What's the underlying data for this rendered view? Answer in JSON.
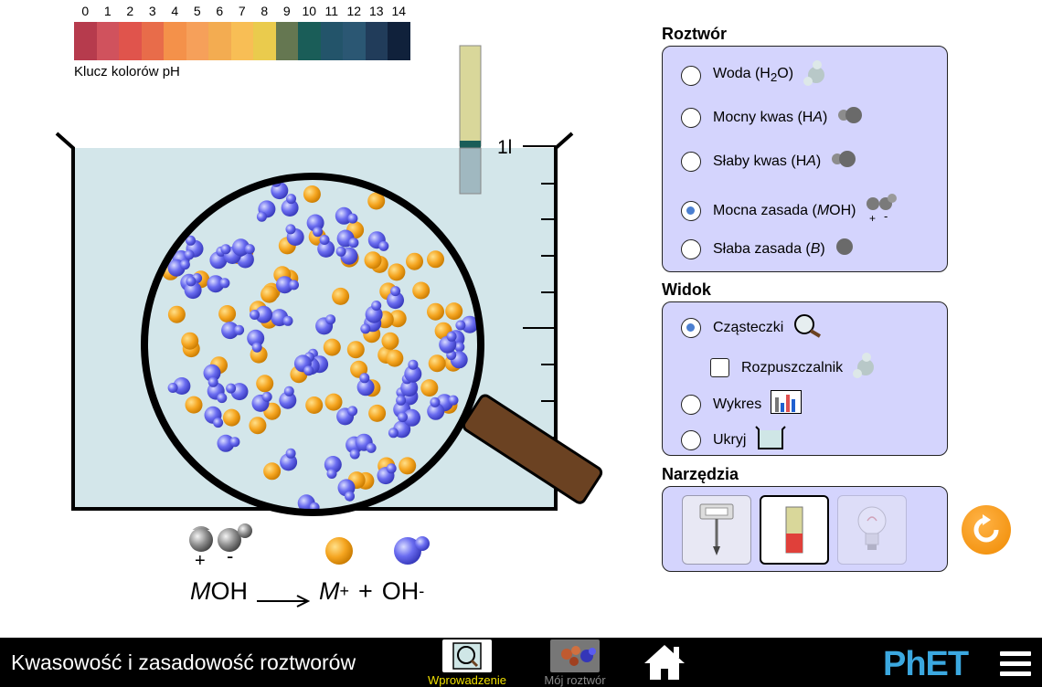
{
  "ph_key": {
    "numbers": [
      "0",
      "1",
      "2",
      "3",
      "4",
      "5",
      "6",
      "7",
      "8",
      "9",
      "10",
      "11",
      "12",
      "13",
      "14"
    ],
    "colors": [
      "#b63b4d",
      "#d0525d",
      "#e0544c",
      "#e86c4a",
      "#f4914a",
      "#f6a05a",
      "#f3ac51",
      "#f8be55",
      "#eacb4d",
      "#657751",
      "#1a5d58",
      "#23546a",
      "#2b5773",
      "#213c5a",
      "#10213b"
    ],
    "label": "Klucz kolorów pH"
  },
  "beaker": {
    "volume_label": "1l",
    "solution_color": "#d3e6ea",
    "ph_paper_color": "#d9d79a",
    "handle_color": "#6b4222"
  },
  "solution_panel": {
    "title": "Roztwór",
    "items": [
      {
        "label_html": "Woda (H<sub>2</sub>O)",
        "selected": false,
        "icon": "water-molecule-icon"
      },
      {
        "label_html": "Mocny kwas (H<i>A</i>)",
        "selected": false,
        "icon": "strong-acid-molecule-icon"
      },
      {
        "label_html": "Słaby kwas (H<i>A</i>)",
        "selected": false,
        "icon": "weak-acid-molecule-icon"
      },
      {
        "label_html": "Mocna zasada (<i>M</i>OH)",
        "selected": true,
        "icon": "strong-base-molecule-icon"
      },
      {
        "label_html": "Słaba zasada (<i>B</i>)",
        "selected": false,
        "icon": "weak-base-molecule-icon"
      }
    ]
  },
  "view_panel": {
    "title": "Widok",
    "molecules_label": "Cząsteczki",
    "molecules_selected": true,
    "solvent_label": "Rozpuszczalnik",
    "solvent_checked": false,
    "graph_label": "Wykres",
    "graph_selected": false,
    "hide_label": "Ukryj",
    "hide_selected": false
  },
  "tools_panel": {
    "title": "Narzędzia",
    "selected_tool": "ph-paper"
  },
  "equation": {
    "reactant_italic": "M",
    "reactant_rest": "OH",
    "product1_italic": "M",
    "product1_sup": "+",
    "plus": "+",
    "product2": "OH",
    "product2_sup": "-",
    "ion_plus": "+",
    "ion_minus": "-"
  },
  "navbar": {
    "title": "Kwasowość i zasadowość roztworów",
    "screens": [
      {
        "label": "Wprowadzenie",
        "active": true
      },
      {
        "label": "Mój roztwór",
        "active": false
      }
    ],
    "logo": "PhET",
    "active_color": "#f0e000",
    "inactive_color": "#8a8a8a"
  }
}
